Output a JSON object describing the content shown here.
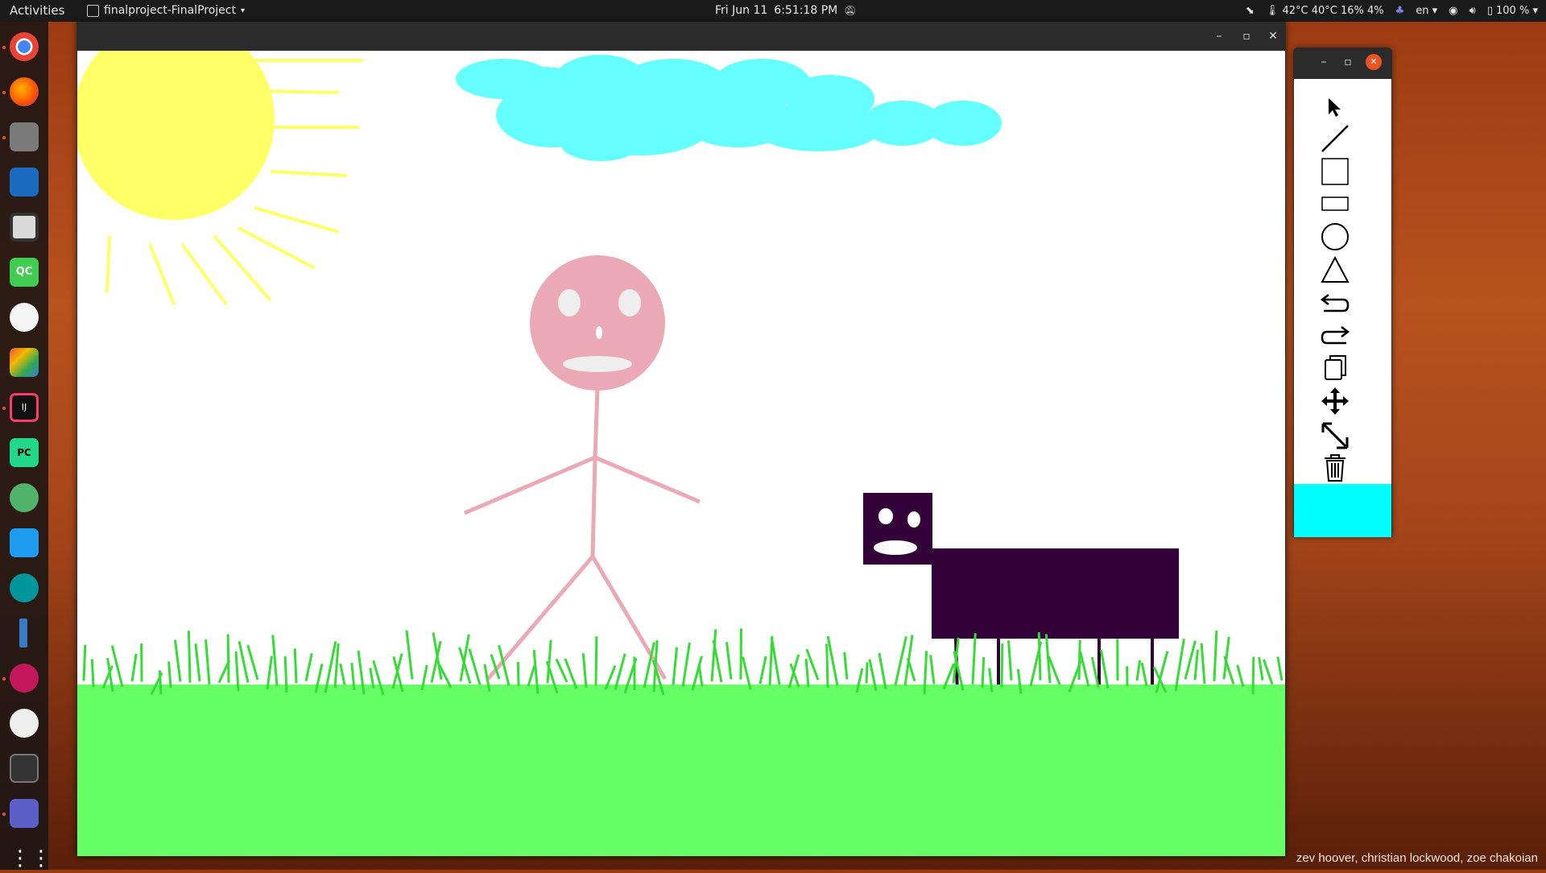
{
  "topbar": {
    "activities": "Activities",
    "app_name": "finalproject-FinalProject",
    "date": "Fri Jun 11",
    "time": "6:51:18 PM",
    "system_stats": "42°C 40°C 16% 4%",
    "language": "en",
    "battery": "100 %"
  },
  "dock": {
    "apps": [
      "chrome-icon",
      "firefox-icon",
      "files-icon",
      "virtualbox-icon",
      "rhythmbox-icon",
      "qt-creator-icon",
      "android-studio-icon",
      "app-store-icon",
      "intellij-icon",
      "pycharm-icon",
      "atom-icon",
      "vscode-icon",
      "arduino-icon",
      "ruler-icon",
      "audio-recorder-icon",
      "github-icon",
      "system-monitor-icon",
      "teams-icon",
      "show-apps-icon"
    ]
  },
  "tool_window": {
    "tools": [
      "select-tool-icon",
      "line-tool-icon",
      "square-tool-icon",
      "rectangle-tool-icon",
      "circle-tool-icon",
      "triangle-tool-icon",
      "undo-icon",
      "redo-icon",
      "copy-icon",
      "move-icon",
      "resize-icon",
      "delete-icon"
    ],
    "current_color": "#00ffff"
  },
  "colors": {
    "sun": "#ffff66",
    "cloud": "#66ffff",
    "person": "#eba8b5",
    "dog": "#33003a",
    "grass": "#66ff66",
    "grass_blades": "#33dd33"
  },
  "credits": "zev hoover, christian lockwood, zoe chakoian"
}
